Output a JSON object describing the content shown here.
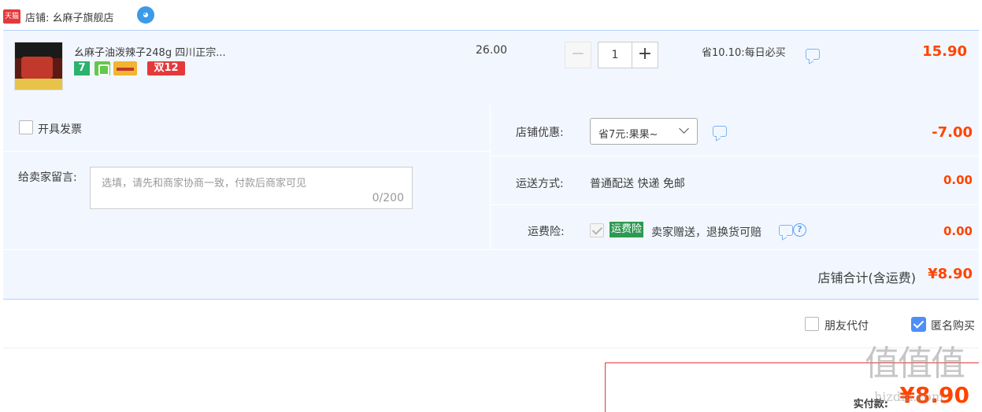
{
  "shop": {
    "badge": "天猫",
    "label": "店铺: 幺麻子旗舰店",
    "ww_icon": "wangwang-chat-icon"
  },
  "item": {
    "title": "幺麻子油泼辣子248g 四川正宗...",
    "service_tags": [
      "7",
      "guarantee",
      "card",
      "双12"
    ],
    "tag_7": "7",
    "tag_double12": "双12",
    "unit_price": "26.00",
    "quantity": "1",
    "minus_label": "−",
    "plus_label": "+",
    "promo": "省10.10:每日必买",
    "total": "15.90"
  },
  "options": {
    "invoice_label": "开具发票",
    "message_label": "给卖家留言:",
    "message_placeholder": "选填，请先和商家协商一致，付款后商家可见",
    "message_counter": "0/200",
    "shop_discount_label": "店铺优惠:",
    "shop_discount_selected": "省7元:果果~",
    "shop_discount_value": "-7.00",
    "shipping_label": "运送方式:",
    "shipping_method": "普通配送 快递 免邮",
    "shipping_value": "0.00",
    "insurance_label": "运费险:",
    "insurance_badge": "运费险",
    "insurance_desc": "卖家赠送，退换货可赔",
    "insurance_value": "0.00",
    "shop_total_label": "店铺合计(含运费)",
    "shop_total_value": "¥8.90"
  },
  "payment": {
    "friend_pay_label": "朋友代付",
    "friend_pay_checked": false,
    "anonymous_label": "匿名购买",
    "anonymous_checked": true,
    "actual_pay_label": "实付款:",
    "actual_pay_value": "¥8.90"
  },
  "watermark": {
    "line1": "值值值",
    "line2": "hizdm.com"
  },
  "colors": {
    "accent_red": "#ff4400",
    "panel_bg": "#f2f7ff",
    "panel_border": "#b2d1ff",
    "checkbox_blue": "#4f8ef7",
    "insurance_green": "#2c9a52"
  }
}
